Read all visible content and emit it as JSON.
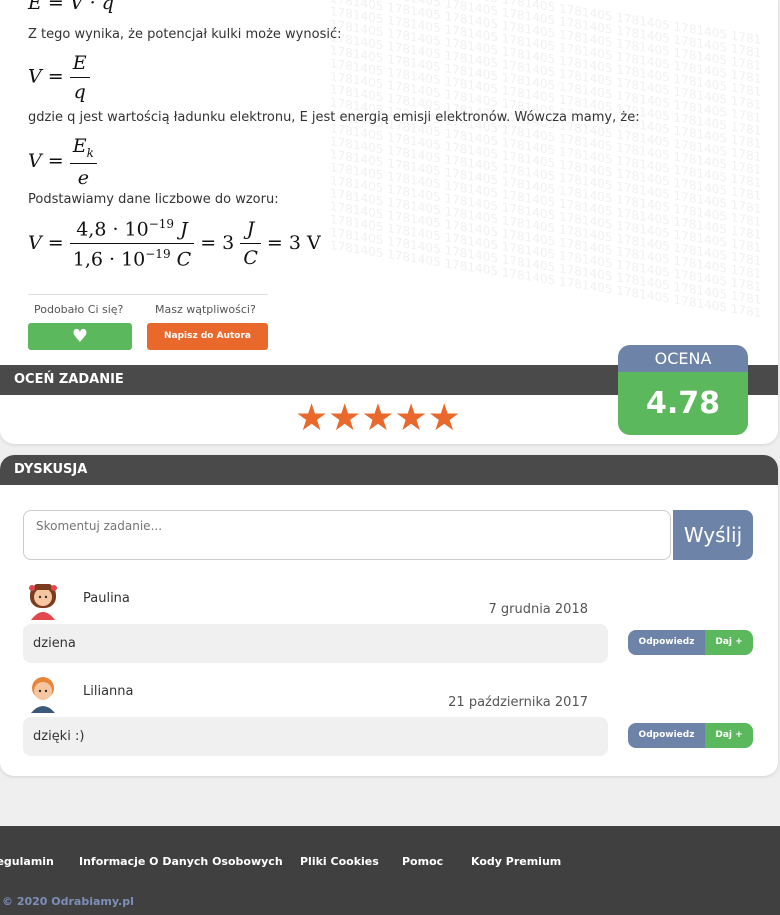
{
  "solution": {
    "eq_top": "E = V · q",
    "intro": "Z tego wynika, że potencjał kulki może wynosić:",
    "eq1_lhs": "V =",
    "eq1_num": "E",
    "eq1_den": "q",
    "explain": "gdzie q jest wartością ładunku elektronu, E jest energią emisji elektronów. Wówcza mamy, że:",
    "eq2_lhs": "V =",
    "eq2_num_main": "E",
    "eq2_num_sub": "k",
    "eq2_den": "e",
    "substitute": "Podstawiamy dane liczbowe do wzoru:",
    "eq3_lhs": "V =",
    "eq3_num": "4,8 · 10",
    "eq3_num_exp": "−19",
    "eq3_num_unit": "J",
    "eq3_den": "1,6 · 10",
    "eq3_den_exp": "−19",
    "eq3_den_unit": "C",
    "eq3_mid": "= 3",
    "eq3_frac_num": "J",
    "eq3_frac_den": "C",
    "eq3_end": "= 3 V",
    "watermark_code": "1781405"
  },
  "feedback": {
    "liked_label": "Podobało Ci się?",
    "doubt_label": "Masz wątpliwości?",
    "heart_icon": "♥",
    "author_button": "Napisz do Autora"
  },
  "rating": {
    "bar_title": "OCEŃ ZADANIE",
    "stars": "★★★★★",
    "grade_title": "OCENA",
    "grade_value": "4.78",
    "colors": {
      "star": "#e8692b",
      "grade_head": "#6e83a8",
      "grade_value": "#5cb85c"
    }
  },
  "discussion": {
    "bar_title": "DYSKUSJA",
    "input_placeholder": "Skomentuj zadanie...",
    "send_button": "Wyślij",
    "comments": [
      {
        "author": "Paulina",
        "date": "7 grudnia 2018",
        "text": "dziena",
        "reply": "Odpowiedz",
        "give": "Daj +",
        "avatar": "girl-avatar"
      },
      {
        "author": "Lilianna",
        "date": "21 października 2017",
        "text": "dzięki :)",
        "reply": "Odpowiedz",
        "give": "Daj +",
        "avatar": "boy-avatar"
      }
    ]
  },
  "footer": {
    "links": [
      "Regulamin",
      "Informacje O Danych Osobowych",
      "Pliki Cookies",
      "Pomoc",
      "Kody Premium"
    ],
    "copyright": "© 2020 Odrabiamy.pl"
  }
}
